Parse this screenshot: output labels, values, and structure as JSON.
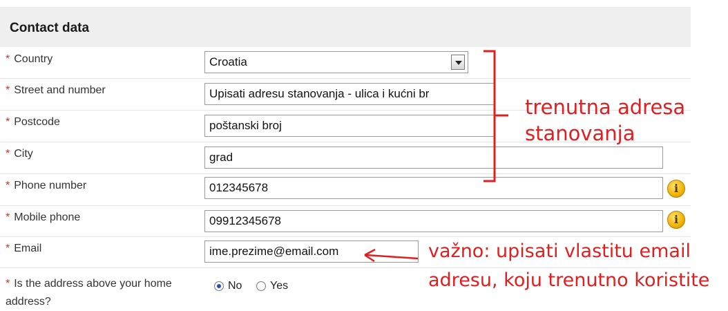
{
  "section": {
    "title": "Contact data"
  },
  "required_marker": "*",
  "fields": {
    "country": {
      "label": "Country",
      "value": "Croatia"
    },
    "street": {
      "label": "Street and number",
      "value": "Upisati adresu stanovanja - ulica i kućni br"
    },
    "postcode": {
      "label": "Postcode",
      "value": "poštanski broj"
    },
    "city": {
      "label": "City",
      "value": "grad"
    },
    "phone": {
      "label": "Phone number",
      "value": "012345678"
    },
    "mobile": {
      "label": "Mobile phone",
      "value": "09912345678"
    },
    "email": {
      "label": "Email",
      "value": "ime.prezime@email.com"
    }
  },
  "home_address": {
    "label_line1": "Is the address above your home",
    "label_line2": "address?",
    "options": [
      "No",
      "Yes"
    ],
    "selected": "No"
  },
  "info_icon_glyph": "i",
  "annotations": {
    "address_note_line1": "trenutna adresa",
    "address_note_line2": "stanovanja",
    "email_note_line1": "važno: upisati vlastitu email",
    "email_note_line2": "adresu, koju trenutno koristite"
  },
  "colors": {
    "annotation": "#e02020",
    "header_bg": "#efefef",
    "required": "#c0392b"
  }
}
